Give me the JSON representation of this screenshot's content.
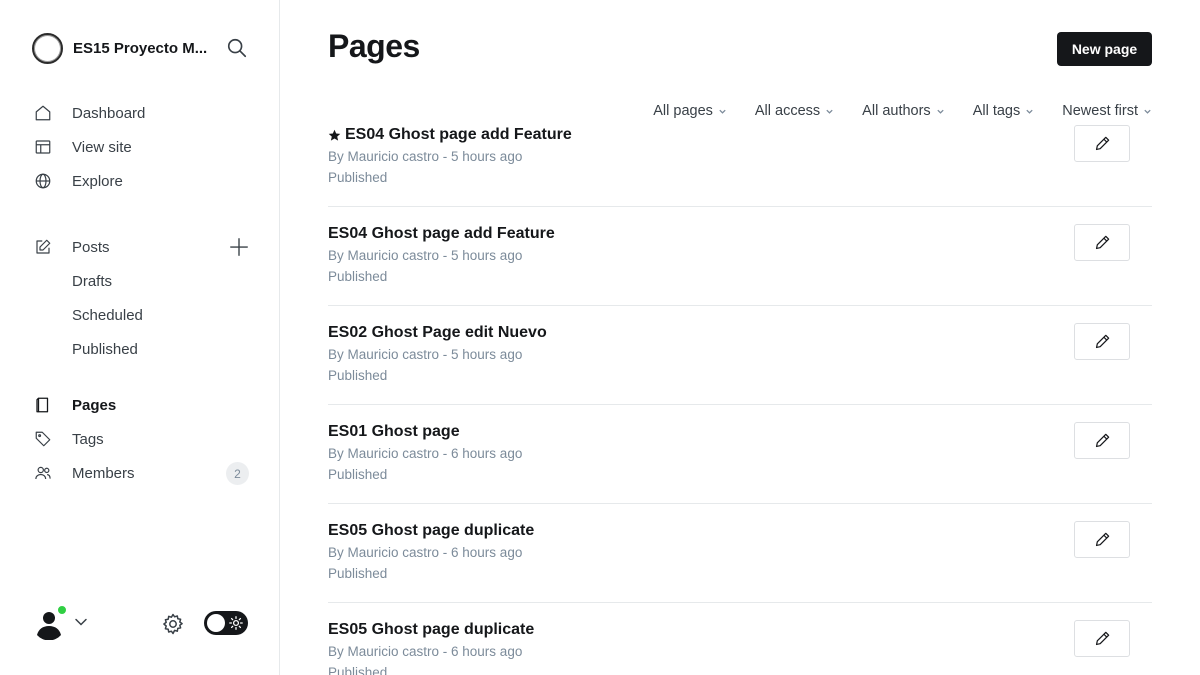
{
  "sidebar": {
    "site_title": "ES15 Proyecto M...",
    "nav_main": [
      {
        "label": "Dashboard",
        "icon": "home-icon"
      },
      {
        "label": "View site",
        "icon": "layout-icon"
      },
      {
        "label": "Explore",
        "icon": "globe-icon"
      }
    ],
    "nav_posts": {
      "label": "Posts",
      "icon": "edit-icon",
      "add_icon": "plus-icon",
      "subitems": [
        {
          "label": "Drafts"
        },
        {
          "label": "Scheduled"
        },
        {
          "label": "Published"
        }
      ]
    },
    "nav_secondary": [
      {
        "label": "Pages",
        "icon": "page-icon",
        "active": true
      },
      {
        "label": "Tags",
        "icon": "tag-icon"
      },
      {
        "label": "Members",
        "icon": "members-icon",
        "badge": "2"
      }
    ],
    "online_status_color": "#30cf43"
  },
  "main": {
    "title": "Pages",
    "new_button": "New page",
    "filters": [
      {
        "label": "All pages"
      },
      {
        "label": "All access"
      },
      {
        "label": "All authors"
      },
      {
        "label": "All tags"
      },
      {
        "label": "Newest first"
      }
    ],
    "pages": [
      {
        "title": "ES04 Ghost page add Feature",
        "featured": true,
        "meta": "By Mauricio castro - 5 hours ago",
        "status": "Published"
      },
      {
        "title": "ES04 Ghost page add Feature",
        "featured": false,
        "meta": "By Mauricio castro - 5 hours ago",
        "status": "Published"
      },
      {
        "title": "ES02 Ghost Page edit Nuevo",
        "featured": false,
        "meta": "By Mauricio castro - 5 hours ago",
        "status": "Published"
      },
      {
        "title": "ES01 Ghost page",
        "featured": false,
        "meta": "By Mauricio castro - 6 hours ago",
        "status": "Published"
      },
      {
        "title": "ES05 Ghost page duplicate",
        "featured": false,
        "meta": "By Mauricio castro - 6 hours ago",
        "status": "Published"
      },
      {
        "title": "ES05 Ghost page duplicate",
        "featured": false,
        "meta": "By Mauricio castro - 6 hours ago",
        "status": "Published"
      }
    ]
  },
  "colors": {
    "accent": "#15171a",
    "muted_text": "#7c8b9a",
    "divider": "#e6e9eb"
  }
}
